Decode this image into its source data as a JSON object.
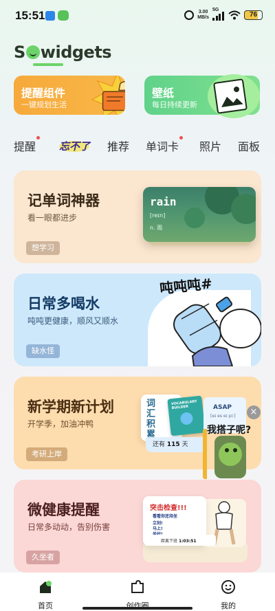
{
  "status_bar": {
    "time": "15:51",
    "net_speed_value": "3.00",
    "net_speed_unit": "MB/s",
    "network": "5G",
    "battery": "76"
  },
  "app": {
    "logo_text_pre": "S",
    "logo_text_post": "widgets"
  },
  "features": [
    {
      "title": "提醒组件",
      "subtitle": "一键规划生活",
      "color": "#f7a93b"
    },
    {
      "title": "壁纸",
      "subtitle": "每日持续更新",
      "color": "#60d28a"
    }
  ],
  "tabs": [
    {
      "label": "提醒",
      "dot": true
    },
    {
      "label": "忘不了",
      "special": true
    },
    {
      "label": "推荐",
      "dot": false
    },
    {
      "label": "单词卡",
      "dot": true
    },
    {
      "label": "照片",
      "dot": false
    },
    {
      "label": "面板",
      "dot": false
    }
  ],
  "cards": [
    {
      "title": "记单词神器",
      "subtitle": "看一眼都进步",
      "tag": "想学习"
    },
    {
      "title": "日常多喝水",
      "subtitle": "吨吨更健康，顺风又顺水",
      "tag": "缺水怪"
    },
    {
      "title": "新学期新计划",
      "subtitle": "开学季，加油冲鸭",
      "tag": "考研上岸"
    },
    {
      "title": "微健康提醒",
      "subtitle": "日常多动动，告别伤害",
      "tag": "久坐者"
    }
  ],
  "card1_art": {
    "word": "rain",
    "phonetic": "[reɪn]",
    "meaning": "n. 雨"
  },
  "card2_art": {
    "chant": "吨吨吨#"
  },
  "card3_art": {
    "vocab_title": "词\n汇\n积\n累",
    "book_title": "VOCABULARY BUILDER",
    "asap_word": "ASAP",
    "asap_phonetic": "[eɪ es eɪ piː]",
    "still_left_prefix": "还有",
    "still_left_days": "115",
    "still_left_suffix": "天"
  },
  "floating": {
    "text": "我搭子呢?",
    "close": "×"
  },
  "card4_art": {
    "alert_title": "突击检查!!!",
    "line1": "看看你还持坐",
    "line2": "立刻!",
    "line3": "马上!",
    "line4": "坐好!",
    "bottom_label": "距离下班",
    "bottom_time": "1:03:51"
  },
  "bottom_nav": [
    {
      "label": "首页",
      "icon": "home-icon",
      "active": true
    },
    {
      "label": "创作圈",
      "icon": "puzzle-icon",
      "active": false
    },
    {
      "label": "我的",
      "icon": "smile-icon",
      "active": false
    }
  ]
}
